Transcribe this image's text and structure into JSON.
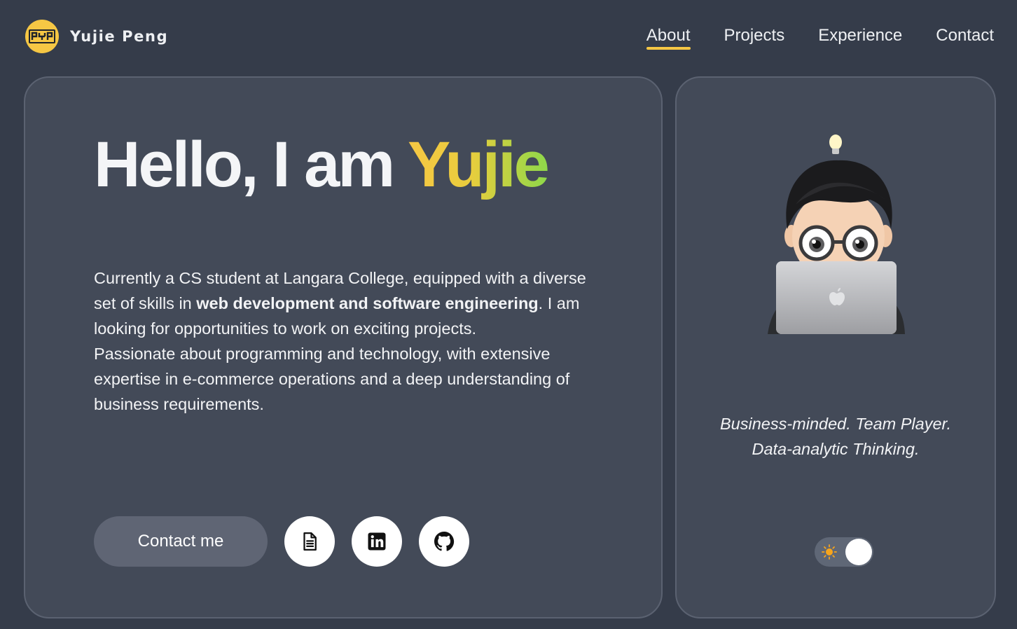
{
  "header": {
    "logo_text": "PYP",
    "site_name": "Yujie Peng",
    "nav": [
      {
        "label": "About",
        "active": true
      },
      {
        "label": "Projects",
        "active": false
      },
      {
        "label": "Experience",
        "active": false
      },
      {
        "label": "Contact",
        "active": false
      }
    ]
  },
  "hero": {
    "greeting": "Hello, I am ",
    "name": "Yujie",
    "bio": {
      "p1_before": "Currently a CS student at Langara College, equipped with a diverse set of skills in ",
      "p1_bold": "web development and software engineering",
      "p1_after": ". I am looking for opportunities to work on exciting projects.",
      "p2": "Passionate about programming and technology, with extensive expertise in e-commerce operations and a deep understanding of business requirements."
    },
    "contact_button": "Contact me",
    "icons": [
      "document-icon",
      "linkedin-icon",
      "github-icon"
    ]
  },
  "side": {
    "tagline_line1": "Business-minded. Team Player.",
    "tagline_line2": "Data-analytic Thinking.",
    "theme_toggle": {
      "icon": "sun-icon",
      "on": true
    }
  },
  "colors": {
    "background": "#353c4a",
    "card": "#434a58",
    "accent": "#f6c744",
    "accent_green": "#8ed84a"
  }
}
